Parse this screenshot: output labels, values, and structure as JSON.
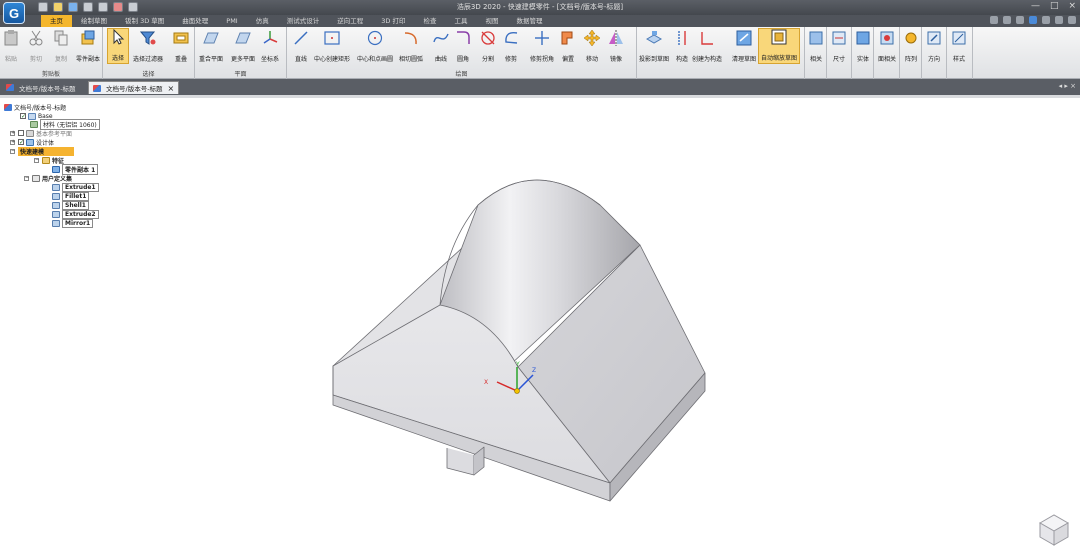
{
  "app": {
    "logo_letter": "G",
    "window_title": "浩辰3D 2020 - 快速建模零件 - [文档号/版本号-标题]",
    "controls": [
      "—",
      "□",
      "×"
    ]
  },
  "tabs": [
    "主页",
    "绘制草图",
    "钣制 3D 草图",
    "曲面处理",
    "PMI",
    "仿真",
    "测试式设计",
    "逆向工程",
    "3D 打印",
    "检查",
    "工具",
    "视图",
    "数据管理"
  ],
  "ribbon": {
    "groups": {
      "clipboard": "剪贴板",
      "select": "选择",
      "plane": "平面",
      "draw": "绘图"
    },
    "buttons": {
      "paste": "粘贴",
      "cut": "剪切",
      "copy": "复制",
      "part_copy": "零件副本",
      "select": "选择",
      "select_filter": "选择过滤器",
      "overlap": "重叠",
      "coincident_plane": "重合平面",
      "more_planes": "更多平面",
      "coord_sys": "坐标系",
      "line": "直线",
      "center_rect": "中心创建矩形",
      "center_circle": "中心和点画圆",
      "tangent_arc": "相切圆弧",
      "curve": "曲线",
      "fillet": "圆角",
      "split": "分割",
      "trim": "修剪",
      "trim_corner": "修剪拐角",
      "offset": "偏置",
      "move": "移动",
      "mirror": "镜像",
      "project_to_sketch": "投影到草图",
      "construct": "构造",
      "create_construct": "创建为构造",
      "clean_sketch": "清理草图",
      "auto_zoom": "自动缩放草图",
      "relate": "相关",
      "dimension": "尺寸",
      "solid": "实体",
      "face_relate": "面相关",
      "pattern": "阵列",
      "direction": "方向",
      "style": "样式"
    }
  },
  "doc_tabs": [
    {
      "label": "文档号/版本号-标题"
    },
    {
      "label": "文档号/版本号-标题"
    }
  ],
  "tree": {
    "root": "文档号/版本号-标题",
    "base": "Base",
    "material": "材料 (无铝铝 1060)",
    "base_planes": "基本参考平面",
    "design_body": "设计体",
    "quick_modeling": "快速建模",
    "features": "特征",
    "part_copy": "零件副本 1",
    "user_defined": "用户定义集",
    "items": [
      "Extrude1",
      "Fillet1",
      "Shell1",
      "Extrude2",
      "Mirror1"
    ]
  },
  "triad": {
    "x": "X",
    "y": "Y",
    "z": "Z"
  },
  "colors": {
    "accent": "#f4b62c",
    "titlebar": "#4b4f55"
  }
}
